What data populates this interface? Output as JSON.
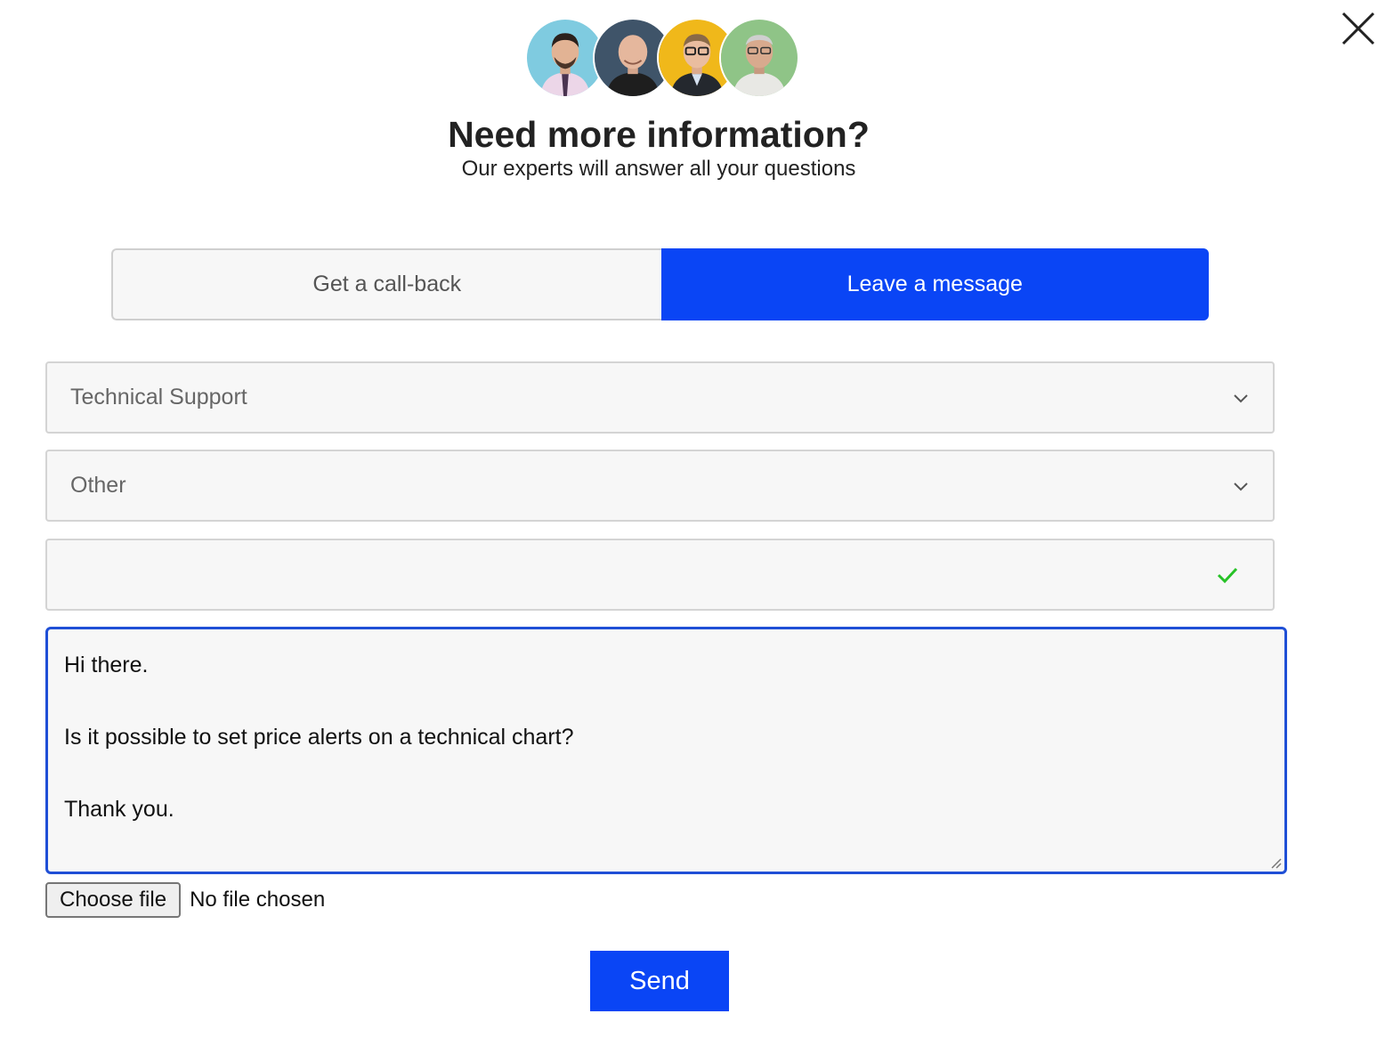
{
  "header": {
    "title": "Need more information?",
    "subtitle": "Our experts will answer all your questions",
    "avatars": [
      {
        "icon": "expert-avatar-1",
        "bg": "#7fcbe0"
      },
      {
        "icon": "expert-avatar-2",
        "bg": "#3f5469"
      },
      {
        "icon": "expert-avatar-3",
        "bg": "#f0b81a"
      },
      {
        "icon": "expert-avatar-4",
        "bg": "#8fc487"
      }
    ]
  },
  "tabs": {
    "callback_label": "Get a call-back",
    "message_label": "Leave a message",
    "active": "Leave a message",
    "active_color": "#0a45f5"
  },
  "form": {
    "department": "Technical Support",
    "topic": "Other",
    "subject_value": "",
    "message": "Hi there.\n\nIs it possible to set price alerts on a technical chart?\n\nThank you.",
    "file_button": "Choose file",
    "file_status": "No file chosen",
    "send_label": "Send"
  },
  "colors": {
    "accent": "#0a45f5",
    "focus_border": "#1f4fd6",
    "valid_check": "#27c227"
  }
}
